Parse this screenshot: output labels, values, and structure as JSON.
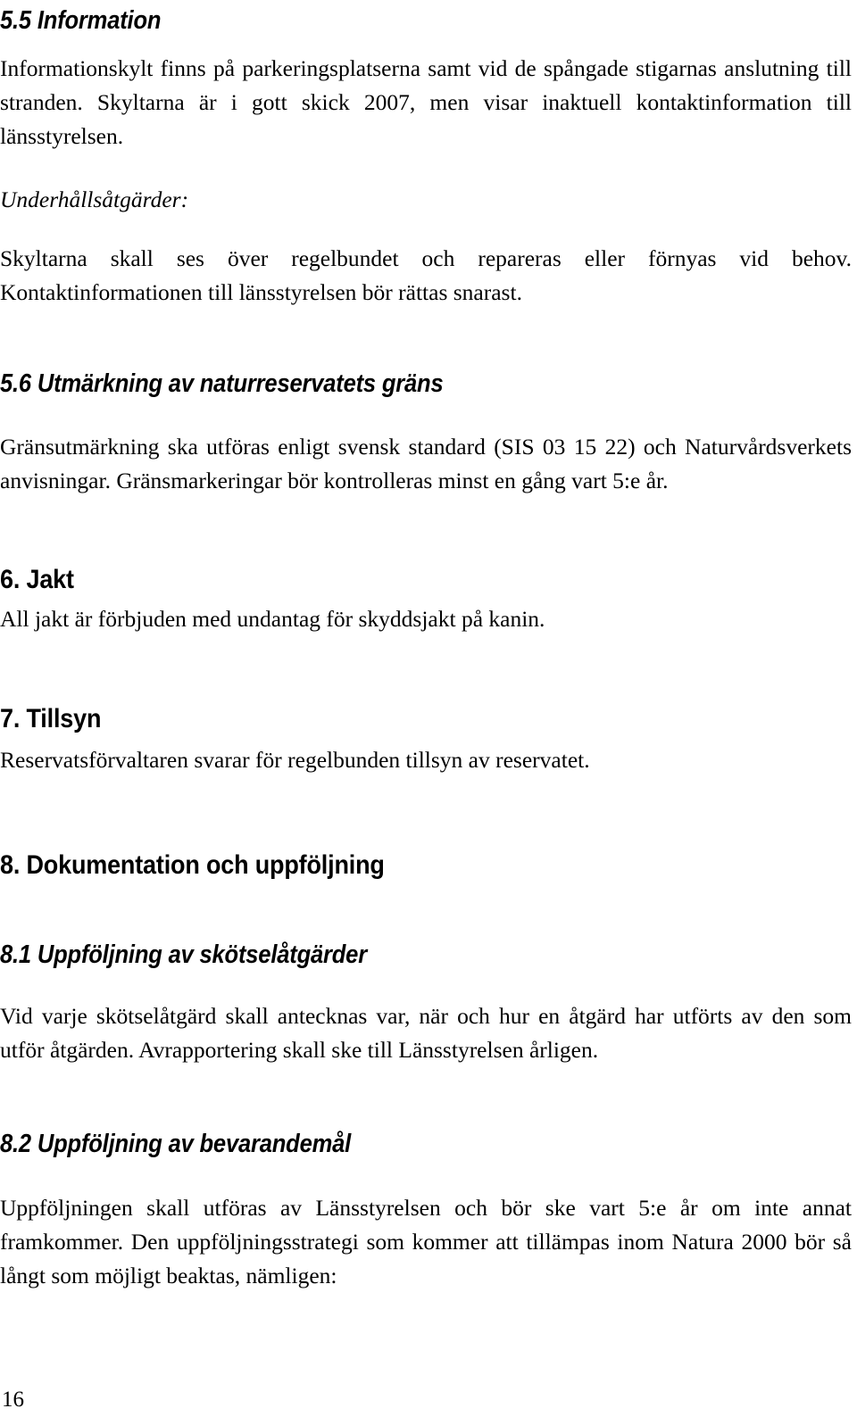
{
  "document": {
    "page_number": "16",
    "language": "sv",
    "blocks": [
      {
        "id": "sec_5_5",
        "type": "heading-sub-italic",
        "text": "5.5 Information"
      },
      {
        "id": "sec_5_5_body",
        "type": "paragraph",
        "text": "Informationskylt finns på parkeringsplatserna samt vid de spångade stigarnas anslutning till stranden. Skyltarna är i gott skick 2007, men visar inaktuell kontaktinformation till länsstyrelsen."
      },
      {
        "id": "underhall_label",
        "type": "paragraph-italic",
        "text": "Underhållsåtgärder:"
      },
      {
        "id": "underhall_body",
        "type": "paragraph",
        "text": "Skyltarna skall ses över regelbundet och repareras eller förnyas vid behov. Kontaktinformationen till länsstyrelsen bör rättas snarast."
      },
      {
        "id": "sec_5_6",
        "type": "heading-sub-italic",
        "text": "5.6 Utmärkning av naturreservatets gräns"
      },
      {
        "id": "sec_5_6_body",
        "type": "paragraph",
        "text": "Gränsutmärkning ska utföras enligt svensk standard (SIS 03 15 22) och Naturvårdsverkets anvisningar. Gränsmarkeringar bör kontrolleras minst en gång vart 5:e år."
      },
      {
        "id": "sec_6",
        "type": "heading-main",
        "text": "6. Jakt"
      },
      {
        "id": "sec_6_body",
        "type": "paragraph",
        "text": "All jakt är förbjuden med undantag för skyddsjakt på kanin."
      },
      {
        "id": "sec_7",
        "type": "heading-main",
        "text": "7. Tillsyn"
      },
      {
        "id": "sec_7_body",
        "type": "paragraph",
        "text": "Reservatsförvaltaren svarar för regelbunden tillsyn av reservatet."
      },
      {
        "id": "sec_8",
        "type": "heading-main",
        "text": "8. Dokumentation och uppföljning"
      },
      {
        "id": "sec_8_1",
        "type": "heading-sub-italic",
        "text": "8.1 Uppföljning av skötselåtgärder"
      },
      {
        "id": "sec_8_1_body",
        "type": "paragraph",
        "text": "Vid varje skötselåtgärd skall antecknas var, när och hur en åtgärd har utförts av den som utför åtgärden. Avrapportering skall ske till Länsstyrelsen årligen."
      },
      {
        "id": "sec_8_2",
        "type": "heading-sub-italic",
        "text": "8.2 Uppföljning av bevarandemål"
      },
      {
        "id": "sec_8_2_body",
        "type": "paragraph",
        "text": "Uppföljningen skall utföras av Länsstyrelsen och bör ske vart 5:e år om inte annat framkommer. Den uppföljningsstrategi som kommer att tillämpas inom Natura 2000 bör så långt som möjligt beaktas, nämligen:"
      }
    ]
  }
}
